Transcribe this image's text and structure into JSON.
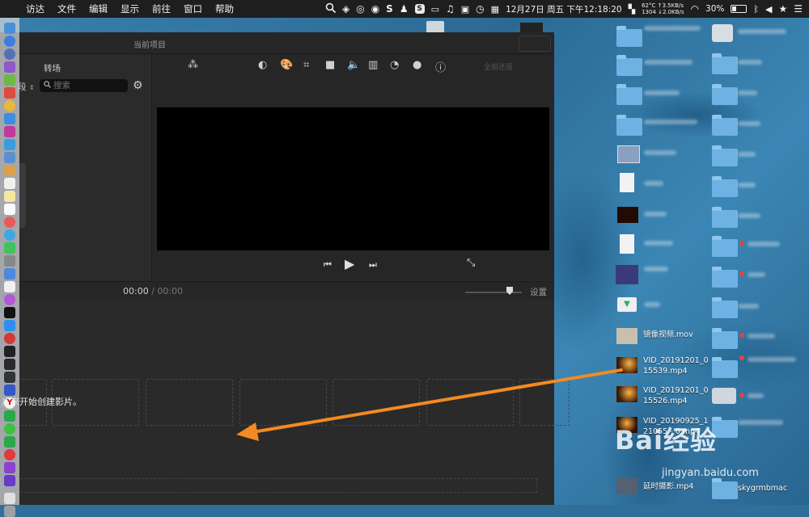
{
  "menubar": {
    "items": [
      "访达",
      "文件",
      "编辑",
      "显示",
      "前往",
      "窗口",
      "帮助"
    ],
    "temp": "62°C",
    "fan": "1304",
    "net_up": "↑3.5KB/s",
    "net_down": "↓2.0KB/s",
    "datetime": "12月27日 周五 下午12:18:20",
    "battery": "30%"
  },
  "imovie": {
    "window_title": "当前项目",
    "browser": {
      "tab_label": "转场",
      "filter_label": "段",
      "search_placeholder": "搜索"
    },
    "viewer": {
      "reset_label": "全部还原"
    },
    "timeline": {
      "time_current": "00:00",
      "time_separator": "/",
      "time_total": "00:00",
      "settings_label": "设置",
      "hint_text": "片来开始创建影片。"
    }
  },
  "desktop": {
    "files": [
      {
        "name": "镜像视频.mov"
      },
      {
        "name": "VID_20191201_015539.mp4",
        "line1": "VID_20191201_0",
        "line2": "15539.mp4"
      },
      {
        "name": "VID_20191201_015526.mp4",
        "line1": "VID_20191201_0",
        "line2": "15526.mp4"
      },
      {
        "name": "VID_20190925_121055",
        "line1": "VID_20190925_1",
        "line2": "21055 - 0.mp4"
      },
      {
        "name": "延时摄影.mp4"
      },
      {
        "name": "skygrmbmac"
      }
    ]
  },
  "watermark": {
    "logo_text": "Bai经验",
    "url": "jingyan.baidu.com"
  },
  "colors": {
    "arrow": "#f28a22",
    "wallpaper": "#2f6f9a",
    "imovie_bg": "#2a2a2a",
    "folder": "#6db2e2"
  }
}
